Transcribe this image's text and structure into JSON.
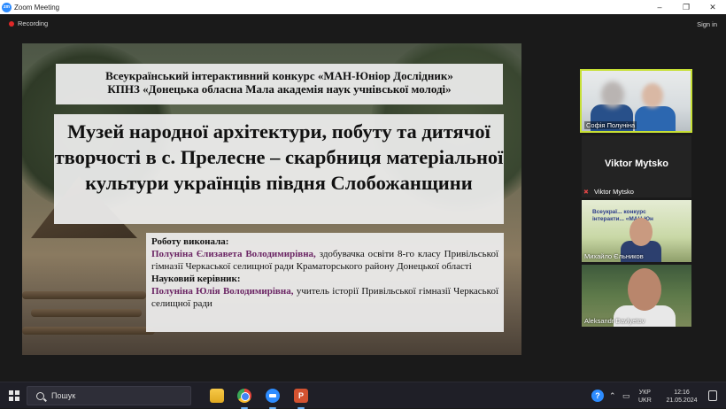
{
  "window": {
    "title": "Zoom Meeting",
    "app_icon_label": "zm",
    "controls": [
      "–",
      "❐",
      "✕"
    ]
  },
  "topbar": {
    "recording_label": "Recording",
    "signin_label": "Sign in"
  },
  "slide": {
    "line1": "Всеукраїнський інтерактивний конкурс «МАН-Юніор Дослідник»",
    "line2": "КПНЗ «Донецька обласна Мала академія наук учнівської молоді»",
    "title": "Музей народної архітектури, побуту та дитячої творчості в с. Прелесне – скарбниця матеріальної культури українців півдня Слобожанщини",
    "author_label": "Роботу виконала:",
    "author_name": "Полуніна Єлизавета Володимирівна,",
    "author_desc": " здобувачка освіти 8-го класу Привільської гімназії Черкаської селищної ради Краматорського району Донецької області",
    "supervisor_label": "Науковий керівник:",
    "supervisor_name": "Полуніна Юлія Володимирівна,",
    "supervisor_desc": " учитель історії Привільської гімназії Черкаської селищної ради"
  },
  "participants": [
    {
      "name": "Софія Полуніна"
    },
    {
      "name": "Viktor Mytsko",
      "display": "Viktor Mytsko",
      "muted_icon": "muted-mic-icon"
    },
    {
      "name": "Михайло Єльников",
      "shared_text": "Всеукраї... конкурс\nінтеракти... «МАН-Юн"
    },
    {
      "name": "Aleksandr  Davlyetov"
    }
  ],
  "taskbar": {
    "search_placeholder": "Пошук",
    "ppt_label": "P",
    "lang_top": "УКР",
    "lang_bottom": "UKR",
    "time": "12:16",
    "date": "21.05.2024",
    "help_label": "?"
  }
}
